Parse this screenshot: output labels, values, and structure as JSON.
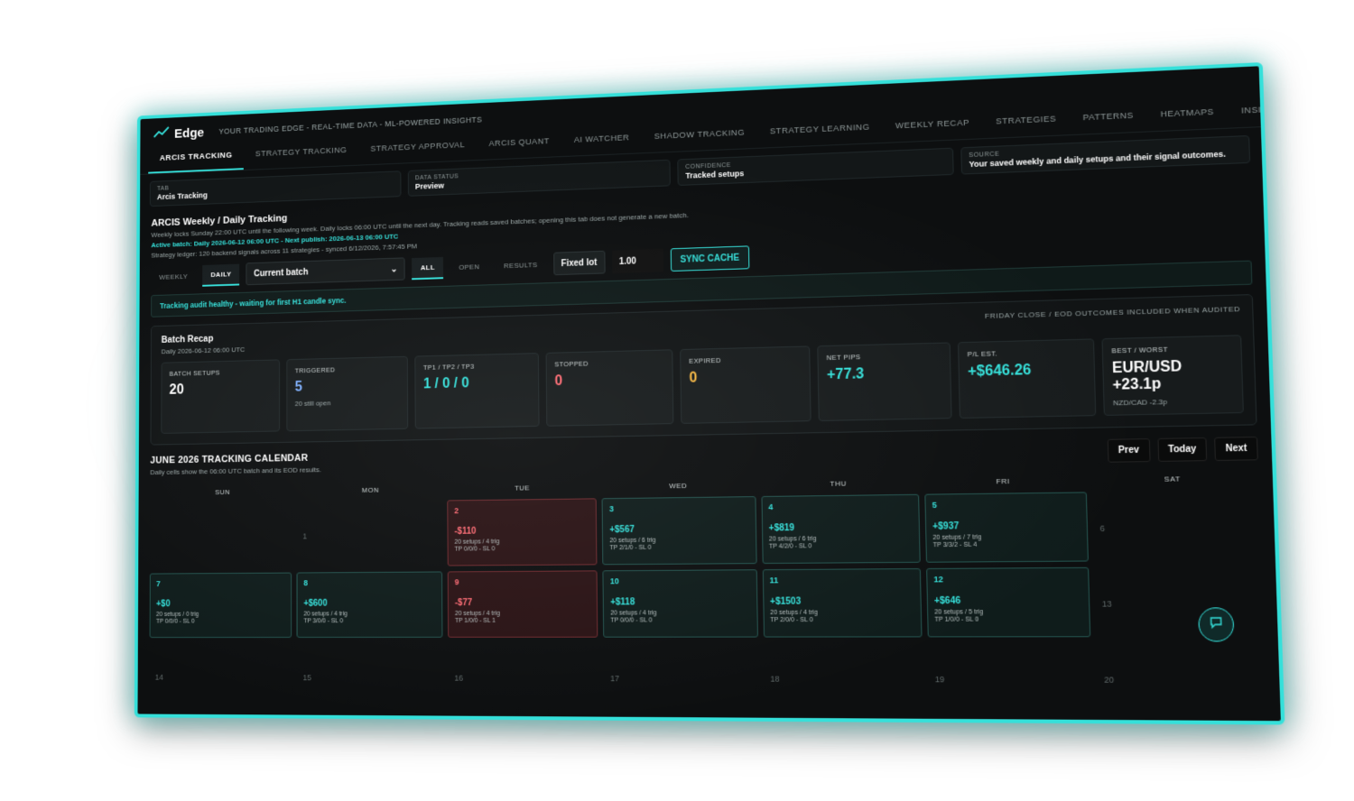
{
  "brand": {
    "name": "Edge",
    "tagline": "YOUR TRADING EDGE - REAL-TIME DATA - ML-POWERED INSIGHTS"
  },
  "tabs": [
    "ARCIS TRACKING",
    "STRATEGY TRACKING",
    "STRATEGY APPROVAL",
    "ARCIS QUANT",
    "AI WATCHER",
    "SHADOW TRACKING",
    "STRATEGY LEARNING",
    "WEEKLY RECAP",
    "STRATEGIES",
    "PATTERNS",
    "HEATMAPS",
    "INSIGHTS"
  ],
  "info": {
    "tab": {
      "k": "TAB",
      "v": "Arcis Tracking"
    },
    "data_status": {
      "k": "DATA STATUS",
      "v": "Preview"
    },
    "confidence": {
      "k": "CONFIDENCE",
      "v": "Tracked setups"
    },
    "source": {
      "k": "SOURCE",
      "v": "Your saved weekly and daily setups and their signal outcomes."
    }
  },
  "tracking": {
    "title": "ARCIS Weekly / Daily Tracking",
    "line1": "Weekly locks Sunday 22:00 UTC until the following week. Daily locks 06:00 UTC until the next day. Tracking reads saved batches; opening this tab does not generate a new batch.",
    "line2": "Active batch: Daily 2026-06-12 06:00 UTC - Next publish: 2026-06-13 06:00 UTC",
    "line3": "Strategy ledger: 120 backend signals across 11 strategies - synced 6/12/2026, 7:57:45 PM"
  },
  "controls": {
    "weekly": "WEEKLY",
    "daily": "DAILY",
    "batch_select": "Current batch",
    "all": "ALL",
    "open": "OPEN",
    "results": "RESULTS",
    "fixed_lot": "Fixed lot",
    "lot_value": "1.00",
    "sync": "SYNC CACHE"
  },
  "audit": "Tracking audit healthy - waiting for first H1 candle sync.",
  "recap": {
    "title": "Batch Recap",
    "subtitle": "Daily 2026-06-12 06:00 UTC",
    "note": "FRIDAY CLOSE / EOD OUTCOMES INCLUDED WHEN AUDITED",
    "stats": [
      {
        "k": "BATCH SETUPS",
        "v": "20",
        "s": "",
        "color": "#ffffff"
      },
      {
        "k": "TRIGGERED",
        "v": "5",
        "s": "20 still open",
        "color": "#7fb0ff"
      },
      {
        "k": "TP1 / TP2 / TP3",
        "v": "1 / 0 / 0",
        "s": "",
        "color": "#35e0da"
      },
      {
        "k": "STOPPED",
        "v": "0",
        "s": "",
        "color": "#ff6b74"
      },
      {
        "k": "EXPIRED",
        "v": "0",
        "s": "",
        "color": "#f5b642"
      },
      {
        "k": "NET PIPS",
        "v": "+77.3",
        "s": "",
        "color": "#35e0da"
      },
      {
        "k": "P/L EST.",
        "v": "+$646.26",
        "s": "",
        "color": "#35e0da"
      },
      {
        "k": "BEST / WORST",
        "v": "EUR/USD +23.1p",
        "s": "NZD/CAD -2.3p",
        "color": "#ffffff"
      }
    ]
  },
  "calendar": {
    "title": "JUNE 2026 TRACKING CALENDAR",
    "subtitle": "Daily cells show the 06:00 UTC batch and its EOD results.",
    "prev": "Prev",
    "today": "Today",
    "next": "Next",
    "dow": [
      "SUN",
      "MON",
      "TUE",
      "WED",
      "THU",
      "FRI",
      "SAT"
    ]
  }
}
